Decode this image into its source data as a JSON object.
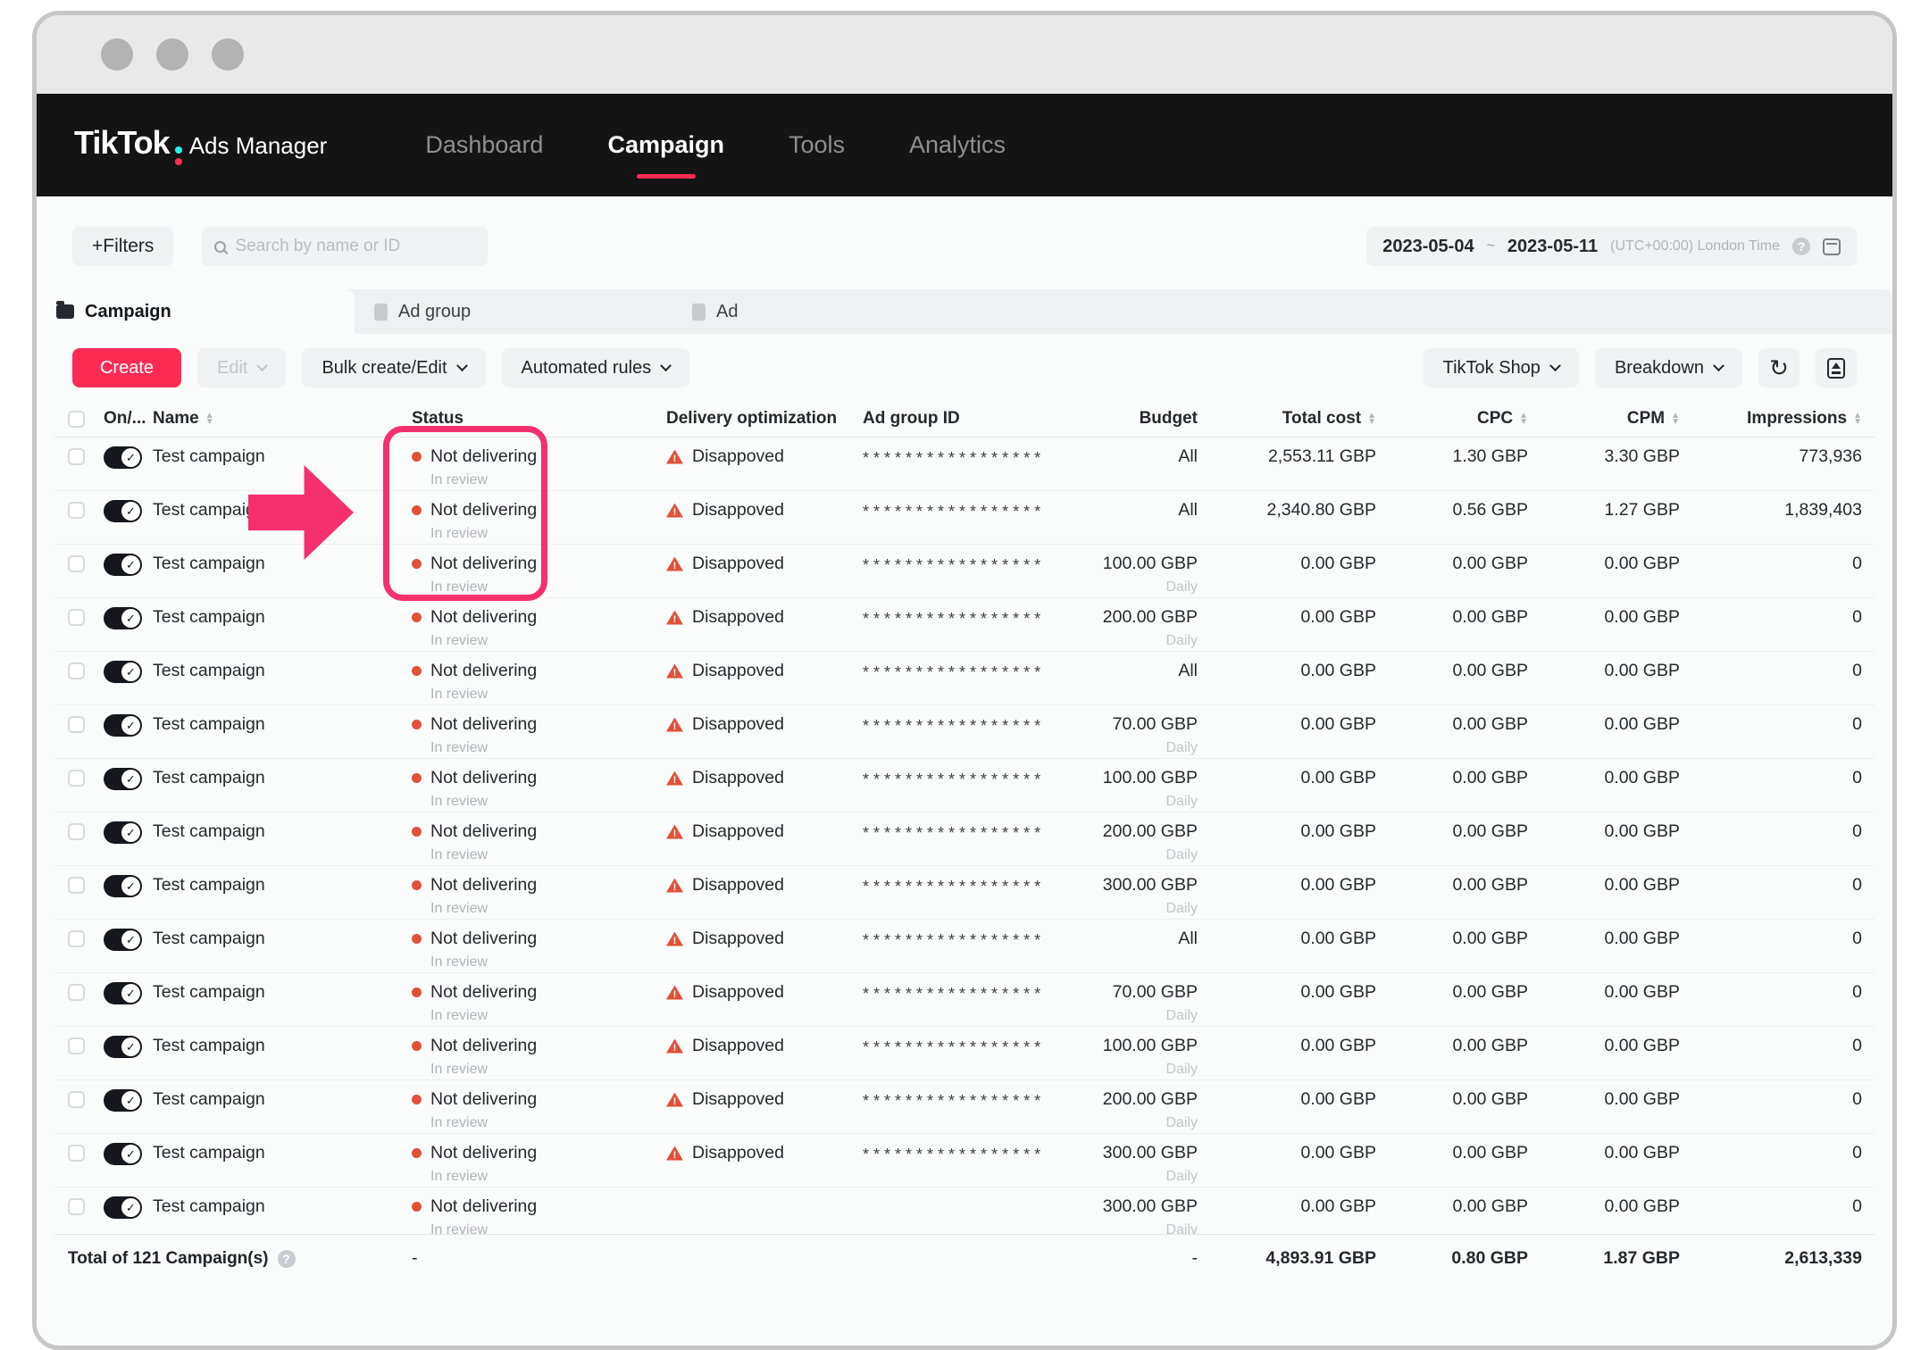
{
  "colors": {
    "accent": "#fe2c55",
    "highlight": "#f5306e",
    "warning": "#e0513a"
  },
  "nav": {
    "logo": "TikTok",
    "brand": "Ads Manager",
    "items": [
      {
        "label": "Dashboard"
      },
      {
        "label": "Campaign"
      },
      {
        "label": "Tools"
      },
      {
        "label": "Analytics"
      }
    ]
  },
  "filters": {
    "filters_button": "+Filters",
    "search_placeholder": "Search by name or ID",
    "date_start": "2023-05-04",
    "date_tilde": "~",
    "date_end": "2023-05-11",
    "timezone": "(UTC+00:00) London Time"
  },
  "tabs": [
    {
      "label": "Campaign"
    },
    {
      "label": "Ad group"
    },
    {
      "label": "Ad"
    }
  ],
  "toolbar": {
    "create": "Create",
    "edit": "Edit",
    "bulk": "Bulk create/Edit",
    "automated": "Automated rules",
    "tiktok_shop": "TikTok Shop",
    "breakdown": "Breakdown"
  },
  "table": {
    "columns": [
      "On/...",
      "Name",
      "Status",
      "Delivery optimization",
      "Ad group ID",
      "Budget",
      "Total cost",
      "CPC",
      "CPM",
      "Impressions"
    ],
    "rows": [
      {
        "name": "Test campaign",
        "status": "Not delivering",
        "substatus": "In review",
        "delivery": "Disappoved",
        "ad_group_id": "*****************",
        "budget": "All",
        "budget_sub": "",
        "total_cost": "2,553.11 GBP",
        "cpc": "1.30 GBP",
        "cpm": "3.30 GBP",
        "impressions": "773,936"
      },
      {
        "name": "Test campaign",
        "status": "Not delivering",
        "substatus": "In review",
        "delivery": "Disappoved",
        "ad_group_id": "*****************",
        "budget": "All",
        "budget_sub": "",
        "total_cost": "2,340.80 GBP",
        "cpc": "0.56 GBP",
        "cpm": "1.27 GBP",
        "impressions": "1,839,403"
      },
      {
        "name": "Test campaign",
        "status": "Not delivering",
        "substatus": "In review",
        "delivery": "Disappoved",
        "ad_group_id": "*****************",
        "budget": "100.00 GBP",
        "budget_sub": "Daily",
        "total_cost": "0.00 GBP",
        "cpc": "0.00 GBP",
        "cpm": "0.00 GBP",
        "impressions": "0"
      },
      {
        "name": "Test campaign",
        "status": "Not delivering",
        "substatus": "In review",
        "delivery": "Disappoved",
        "ad_group_id": "*****************",
        "budget": "200.00 GBP",
        "budget_sub": "Daily",
        "total_cost": "0.00 GBP",
        "cpc": "0.00 GBP",
        "cpm": "0.00 GBP",
        "impressions": "0"
      },
      {
        "name": "Test campaign",
        "status": "Not delivering",
        "substatus": "In review",
        "delivery": "Disappoved",
        "ad_group_id": "*****************",
        "budget": "All",
        "budget_sub": "",
        "total_cost": "0.00 GBP",
        "cpc": "0.00 GBP",
        "cpm": "0.00 GBP",
        "impressions": "0"
      },
      {
        "name": "Test campaign",
        "status": "Not delivering",
        "substatus": "In review",
        "delivery": "Disappoved",
        "ad_group_id": "*****************",
        "budget": "70.00 GBP",
        "budget_sub": "Daily",
        "total_cost": "0.00 GBP",
        "cpc": "0.00 GBP",
        "cpm": "0.00 GBP",
        "impressions": "0"
      },
      {
        "name": "Test campaign",
        "status": "Not delivering",
        "substatus": "In review",
        "delivery": "Disappoved",
        "ad_group_id": "*****************",
        "budget": "100.00 GBP",
        "budget_sub": "Daily",
        "total_cost": "0.00 GBP",
        "cpc": "0.00 GBP",
        "cpm": "0.00 GBP",
        "impressions": "0"
      },
      {
        "name": "Test campaign",
        "status": "Not delivering",
        "substatus": "In review",
        "delivery": "Disappoved",
        "ad_group_id": "*****************",
        "budget": "200.00 GBP",
        "budget_sub": "Daily",
        "total_cost": "0.00 GBP",
        "cpc": "0.00 GBP",
        "cpm": "0.00 GBP",
        "impressions": "0"
      },
      {
        "name": "Test campaign",
        "status": "Not delivering",
        "substatus": "In review",
        "delivery": "Disappoved",
        "ad_group_id": "*****************",
        "budget": "300.00 GBP",
        "budget_sub": "Daily",
        "total_cost": "0.00 GBP",
        "cpc": "0.00 GBP",
        "cpm": "0.00 GBP",
        "impressions": "0"
      },
      {
        "name": "Test campaign",
        "status": "Not delivering",
        "substatus": "In review",
        "delivery": "Disappoved",
        "ad_group_id": "*****************",
        "budget": "All",
        "budget_sub": "",
        "total_cost": "0.00 GBP",
        "cpc": "0.00 GBP",
        "cpm": "0.00 GBP",
        "impressions": "0"
      },
      {
        "name": "Test campaign",
        "status": "Not delivering",
        "substatus": "In review",
        "delivery": "Disappoved",
        "ad_group_id": "*****************",
        "budget": "70.00 GBP",
        "budget_sub": "Daily",
        "total_cost": "0.00 GBP",
        "cpc": "0.00 GBP",
        "cpm": "0.00 GBP",
        "impressions": "0"
      },
      {
        "name": "Test campaign",
        "status": "Not delivering",
        "substatus": "In review",
        "delivery": "Disappoved",
        "ad_group_id": "*****************",
        "budget": "100.00 GBP",
        "budget_sub": "Daily",
        "total_cost": "0.00 GBP",
        "cpc": "0.00 GBP",
        "cpm": "0.00 GBP",
        "impressions": "0"
      },
      {
        "name": "Test campaign",
        "status": "Not delivering",
        "substatus": "In review",
        "delivery": "Disappoved",
        "ad_group_id": "*****************",
        "budget": "200.00 GBP",
        "budget_sub": "Daily",
        "total_cost": "0.00 GBP",
        "cpc": "0.00 GBP",
        "cpm": "0.00 GBP",
        "impressions": "0"
      },
      {
        "name": "Test campaign",
        "status": "Not delivering",
        "substatus": "In review",
        "delivery": "Disappoved",
        "ad_group_id": "*****************",
        "budget": "300.00 GBP",
        "budget_sub": "Daily",
        "total_cost": "0.00 GBP",
        "cpc": "0.00 GBP",
        "cpm": "0.00 GBP",
        "impressions": "0"
      },
      {
        "name": "Test campaign",
        "status": "Not delivering",
        "substatus": "In review",
        "delivery": "",
        "ad_group_id": "",
        "budget": "300.00 GBP",
        "budget_sub": "Daily",
        "total_cost": "0.00 GBP",
        "cpc": "0.00 GBP",
        "cpm": "0.00 GBP",
        "impressions": "0"
      }
    ],
    "footer": {
      "label": "Total of 121 Campaign(s)",
      "status_dash": "-",
      "budget_dash": "-",
      "total_cost": "4,893.91 GBP",
      "cpc": "0.80 GBP",
      "cpm": "1.87 GBP",
      "impressions": "2,613,339"
    }
  }
}
